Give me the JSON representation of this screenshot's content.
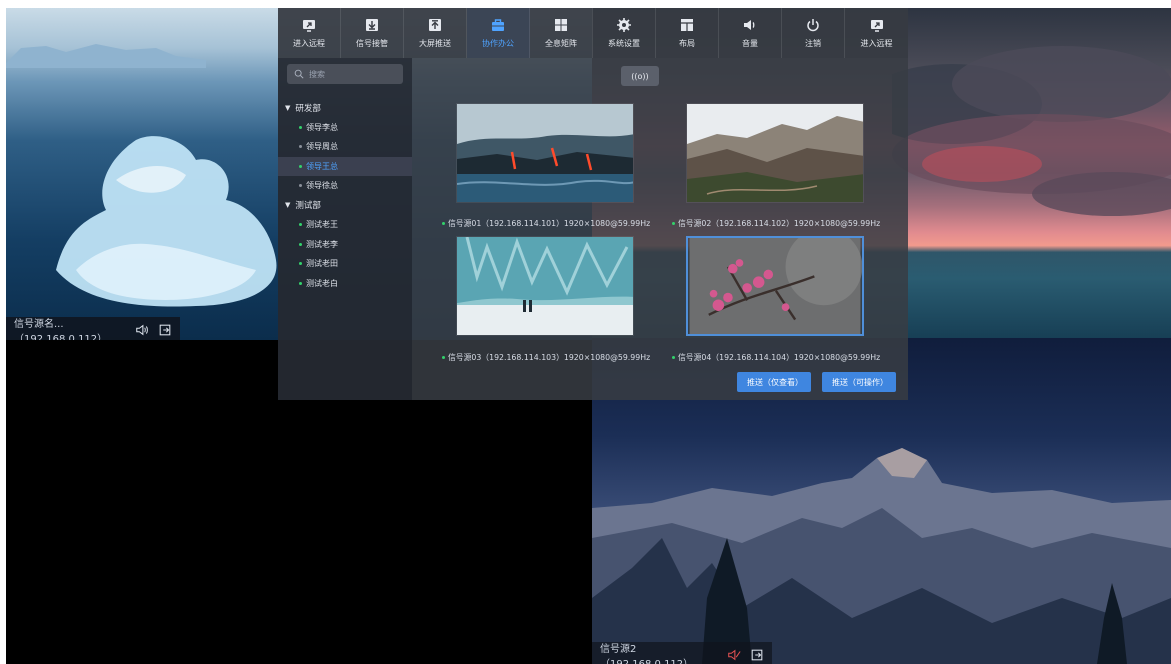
{
  "toolbar": {
    "items": [
      {
        "label": "进入远程",
        "icon": "enter-remote-icon"
      },
      {
        "label": "信号接管",
        "icon": "download-icon"
      },
      {
        "label": "大屏推送",
        "icon": "upload-icon"
      },
      {
        "label": "协作办公",
        "icon": "briefcase-icon"
      },
      {
        "label": "全息矩阵",
        "icon": "grid-icon"
      },
      {
        "label": "系统设置",
        "icon": "gear-icon"
      },
      {
        "label": "布局",
        "icon": "layout-icon"
      },
      {
        "label": "音量",
        "icon": "speaker-icon"
      },
      {
        "label": "注销",
        "icon": "power-icon"
      },
      {
        "label": "进入远程",
        "icon": "enter-remote-icon"
      }
    ],
    "active_index": 3
  },
  "panel": {
    "search_placeholder": "搜索",
    "tree": [
      {
        "group": "研发部",
        "children": [
          {
            "label": "领导李总",
            "online": true
          },
          {
            "label": "领导周总",
            "online": false
          },
          {
            "label": "领导王总",
            "online": true,
            "selected": true
          },
          {
            "label": "领导徐总",
            "online": false
          }
        ]
      },
      {
        "group": "测试部",
        "children": [
          {
            "label": "测试老王",
            "online": true
          },
          {
            "label": "测试老李",
            "online": true
          },
          {
            "label": "测试老田",
            "online": true
          },
          {
            "label": "测试老白",
            "online": true
          }
        ]
      }
    ],
    "broadcast_label": "((o))",
    "sources": [
      {
        "caption": "信号源01（192.168.114.101）1920×1080@59.99Hz"
      },
      {
        "caption": "信号源02（192.168.114.102）1920×1080@59.99Hz"
      },
      {
        "caption": "信号源03（192.168.114.103）1920×1080@59.99Hz"
      },
      {
        "caption": "信号源04（192.168.114.104）1920×1080@59.99Hz",
        "selected": true
      }
    ],
    "push_view_label": "推送（仅查看）",
    "push_operate_label": "推送（可操作）"
  },
  "windows": {
    "left_source_label": "信号源名...（192.168.0.112）",
    "bottom_source_label": "信号源2（192.168.0.112）"
  },
  "colors": {
    "accent": "#4fa3ff",
    "online": "#33d26b",
    "button": "#3f86e0"
  }
}
